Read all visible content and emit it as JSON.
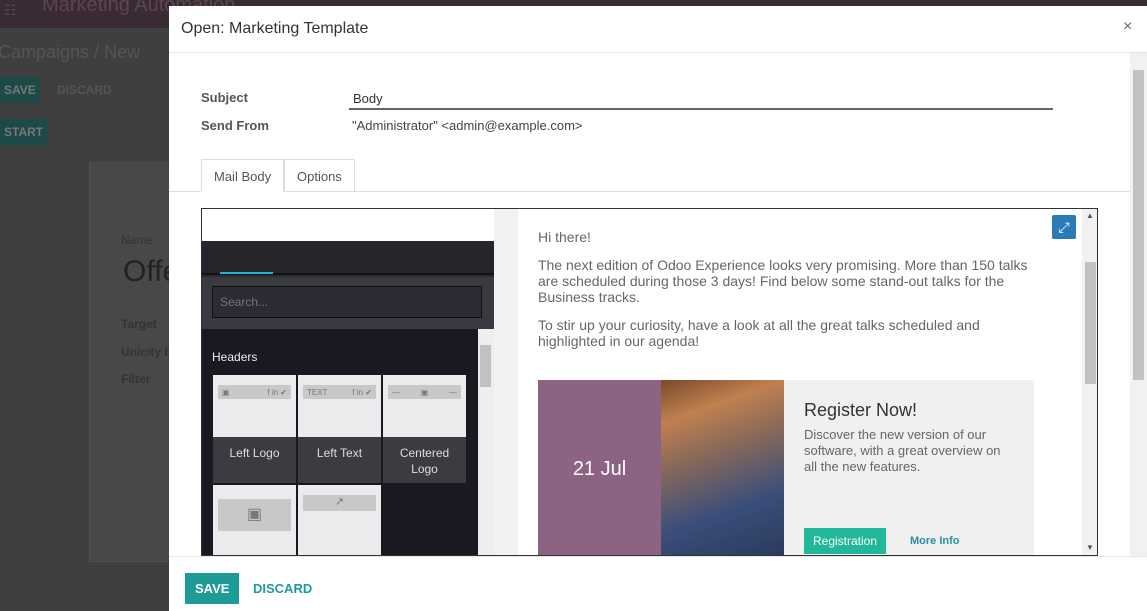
{
  "background": {
    "app_name": "Marketing Automation",
    "breadcrumb": "Campaigns / New",
    "save": "SAVE",
    "discard": "DISCARD",
    "start": "START",
    "name_label": "Name",
    "name_value": "Offe",
    "fields": [
      "Target",
      "Unicity b",
      "Filter"
    ]
  },
  "modal": {
    "title": "Open: Marketing Template",
    "close": "×",
    "subject_label": "Subject",
    "subject_value": "Body",
    "send_from_label": "Send From",
    "send_from_value": "\"Administrator\" <admin@example.com>",
    "tabs": [
      {
        "label": "Mail Body",
        "active": true
      },
      {
        "label": "Options",
        "active": false
      }
    ],
    "snippets": {
      "search_placeholder": "Search...",
      "section": "Headers",
      "items": [
        {
          "label": "Left Logo",
          "bar_left": "▣",
          "bar_right": "f in ✔"
        },
        {
          "label": "Left Text",
          "bar_left": "TEXT",
          "bar_right": "f in ✔"
        },
        {
          "label": "Centered Logo",
          "bar_left": "—",
          "bar_right": "—"
        },
        {
          "label": "",
          "bar_left": "",
          "bar_right": ""
        },
        {
          "label": "",
          "bar_left": "",
          "bar_right": ""
        }
      ]
    },
    "content": {
      "greeting": "Hi there!",
      "para1": "The next edition of Odoo Experience looks very promising. More than 150 talks are scheduled during those 3 days! Find below some stand-out talks for the Business tracks.",
      "para2": "To stir up your curiosity, have a look at all the great talks scheduled and highlighted in our agenda!",
      "banner": {
        "date": "21 Jul",
        "title": "Register Now!",
        "text": "Discover the new version of our software, with a great overview on all the new features.",
        "registration": "Registration",
        "more_info": "More Info"
      }
    },
    "footer": {
      "save": "SAVE",
      "discard": "DISCARD"
    },
    "colors": {
      "accent": "#1d9c97",
      "banner_purple": "#8d6383",
      "registration": "#21b799"
    }
  }
}
